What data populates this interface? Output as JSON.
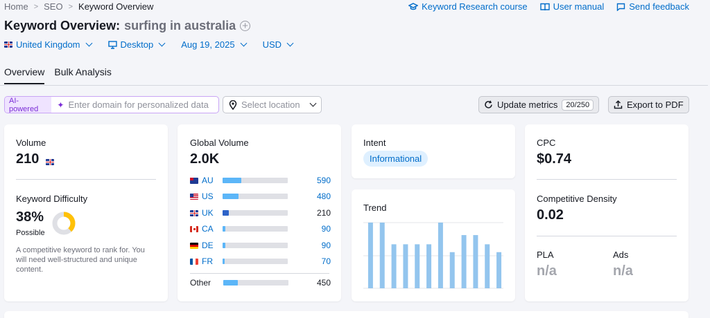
{
  "breadcrumb": [
    "Home",
    "SEO",
    "Keyword Overview"
  ],
  "top_links": [
    {
      "label": "Keyword Research course",
      "icon": "graduation-cap-icon"
    },
    {
      "label": "User manual",
      "icon": "book-icon"
    },
    {
      "label": "Send feedback",
      "icon": "message-icon"
    }
  ],
  "title": {
    "prefix": "Keyword Overview:",
    "keyword": "surfing in australia"
  },
  "filters": {
    "database": "United Kingdom",
    "device": "Desktop",
    "date": "Aug 19, 2025",
    "currency": "USD"
  },
  "tabs": [
    "Overview",
    "Bulk Analysis"
  ],
  "ai": {
    "badge": "AI-powered",
    "placeholder": "Enter domain for personalized data"
  },
  "location": {
    "placeholder": "Select location"
  },
  "update": {
    "label": "Update metrics",
    "count": "20/250"
  },
  "export": {
    "label": "Export to PDF"
  },
  "volume": {
    "label": "Volume",
    "value": "210"
  },
  "kd": {
    "label": "Keyword Difficulty",
    "value": "38%",
    "level": "Possible",
    "percent": 38,
    "description": "A competitive keyword to rank for. You will need well-structured and unique content."
  },
  "global": {
    "label": "Global Volume",
    "value": "2.0K",
    "rows": [
      {
        "code": "AU",
        "value": "590",
        "flag": "au",
        "fraction": 0.29,
        "color": "#5cb6f8"
      },
      {
        "code": "US",
        "value": "480",
        "flag": "us",
        "fraction": 0.24,
        "color": "#5cb6f8"
      },
      {
        "code": "UK",
        "value": "210",
        "flag": "uk",
        "fraction": 0.1,
        "color": "#2d63c8"
      },
      {
        "code": "CA",
        "value": "90",
        "flag": "ca",
        "fraction": 0.045,
        "color": "#5cb6f8"
      },
      {
        "code": "DE",
        "value": "90",
        "flag": "de",
        "fraction": 0.045,
        "color": "#5cb6f8"
      },
      {
        "code": "FR",
        "value": "70",
        "flag": "fr",
        "fraction": 0.035,
        "color": "#5cb6f8"
      }
    ],
    "other": {
      "label": "Other",
      "value": "450",
      "fraction": 0.22
    }
  },
  "intent": {
    "label": "Intent",
    "chip": "Informational"
  },
  "trend": {
    "label": "Trend",
    "values": [
      1.0,
      1.0,
      0.67,
      0.67,
      0.67,
      0.67,
      1.0,
      0.55,
      0.81,
      0.81,
      0.67,
      0.55
    ]
  },
  "cpc": {
    "label": "CPC",
    "value": "$0.74"
  },
  "density": {
    "label": "Competitive Density",
    "value": "0.02"
  },
  "pla": {
    "label": "PLA",
    "value": "n/a"
  },
  "ads": {
    "label": "Ads",
    "value": "n/a"
  },
  "colors": {
    "link": "#006dca",
    "kd_ring": "#ffc107",
    "trend_bar": "#93c5ee"
  }
}
